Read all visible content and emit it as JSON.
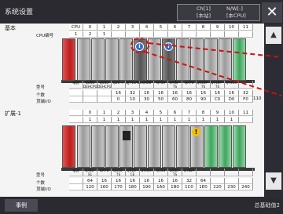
{
  "window": {
    "title": "系统设置"
  },
  "cpu_indicator": {
    "line1": "Ch[1]",
    "line2": "[本站]",
    "line3": "N/W[-]",
    "line4": "[本CPU]"
  },
  "sections": {
    "base": {
      "label": "基本",
      "slot_numbers": [
        "CPU",
        "0",
        "1",
        "2",
        "3",
        "4",
        "5",
        "6",
        "7",
        "8",
        "9",
        "10",
        "11"
      ],
      "cpu_numbers": [
        "1",
        "2",
        "1",
        "",
        "",
        "",
        "",
        "",
        "",
        "",
        "",
        "",
        ""
      ],
      "model_names": [
        "电源",
        "Q06U DEHCPU",
        "Q06U DEHCPU",
        "Q25 ...",
        "QJ71LP25",
        "QX28",
        "QY50",
        "QY80 -TS",
        "QX70",
        "QX40P -TS",
        "QY40P -TS",
        "QY41H",
        ""
      ],
      "counts": [
        "",
        "",
        "",
        "16",
        "32",
        "16",
        "16",
        "16",
        "16",
        "16",
        "16",
        "16",
        "32"
      ],
      "start_io": [
        "",
        "",
        "",
        "0",
        "10",
        "30",
        "50",
        "60",
        "80",
        "90",
        "C0",
        "D0",
        "F0"
      ],
      "tail_start_io": "110"
    },
    "ext1": {
      "label": "扩展-1",
      "slot_numbers": [
        "",
        "0",
        "1",
        "2",
        "3",
        "4",
        "5",
        "6",
        "7",
        "8",
        "9",
        "10",
        "11"
      ],
      "cpu_numbers": [
        "",
        "1",
        "1",
        "1",
        "1",
        "1",
        "1",
        "1",
        "1",
        "1",
        "1",
        "1",
        ""
      ],
      "model_names": [
        "电源",
        "QX42-S1",
        "QX70",
        "QX10-TS",
        "QX10 -CE",
        "QX40H",
        "QX40",
        "QX60 -TS",
        "QY82P",
        "",
        "",
        "",
        ""
      ],
      "counts": [
        "",
        "64",
        "16",
        "16",
        "16",
        "16",
        "16",
        "16",
        "32",
        "64",
        "",
        "",
        ""
      ],
      "start_io": [
        "",
        "120",
        "160",
        "170",
        "180",
        "190",
        "1A0",
        "1B0",
        "1C0",
        "1E0",
        "220",
        "230",
        "240"
      ]
    }
  },
  "row_labels": {
    "cpu_no": "CPU编号",
    "model": "型号",
    "count": "个数",
    "start_io": "顶端I/O"
  },
  "badges": {
    "info": "i",
    "warning": "!"
  },
  "sidebar": {
    "up": "▲",
    "down": "▼"
  },
  "bottom": {
    "tab_label": "事例",
    "status": "总基础值2"
  },
  "close_icon_glyph": "✕"
}
